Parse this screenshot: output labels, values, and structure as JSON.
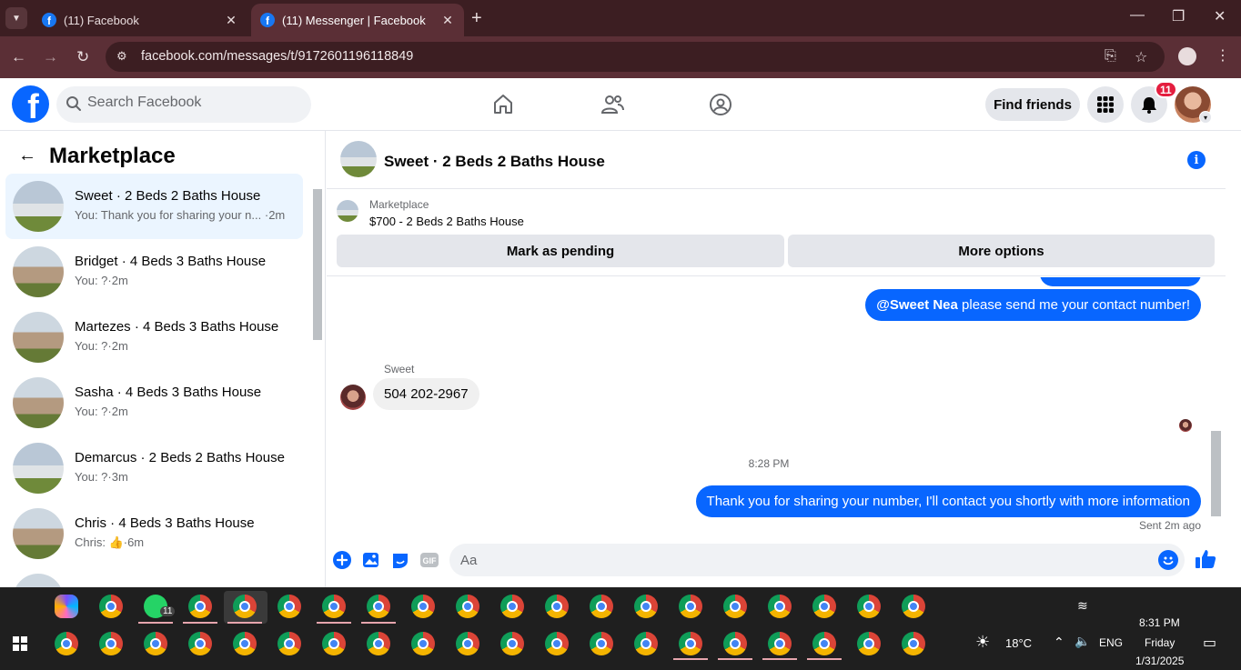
{
  "browser": {
    "tabs": [
      {
        "title": "(11) Facebook",
        "active": false
      },
      {
        "title": "(11) Messenger | Facebook",
        "active": true
      }
    ],
    "url": "facebook.com/messages/t/9172601196118849"
  },
  "fb": {
    "search_placeholder": "Search Facebook",
    "find_friends": "Find friends",
    "notification_count": "11"
  },
  "sidebar": {
    "title": "Marketplace",
    "conversations": [
      {
        "name": "Sweet · 2 Beds 2 Baths House",
        "snippet": "You: Thank you for sharing your n...",
        "time": "·2m",
        "thumb": "house-white",
        "active": true
      },
      {
        "name": "Bridget · 4 Beds 3 Baths House",
        "snippet": "You: ?",
        "time": "·2m",
        "thumb": "house-tan",
        "active": false
      },
      {
        "name": "Martezes · 4 Beds 3 Baths House",
        "snippet": "You: ?",
        "time": "·2m",
        "thumb": "house-tan",
        "active": false
      },
      {
        "name": "Sasha · 4 Beds 3 Baths House",
        "snippet": "You: ?",
        "time": "·2m",
        "thumb": "house-tan",
        "active": false
      },
      {
        "name": "Demarcus · 2 Beds 2 Baths House",
        "snippet": "You: ?",
        "time": "·3m",
        "thumb": "house-white",
        "active": false
      },
      {
        "name": "Chris · 4 Beds 3 Baths House",
        "snippet": "Chris: 👍",
        "time": "·6m",
        "thumb": "house-tan",
        "active": false
      }
    ]
  },
  "chat": {
    "title": "Sweet · 2 Beds 2 Baths House",
    "listing_kind": "Marketplace",
    "listing_price": "$700 - 2 Beds 2 Baths House",
    "mark_pending": "Mark as pending",
    "more_options": "More options",
    "messages": {
      "out1_mention": "@Sweet Nea",
      "out1_text": " please send me your contact number!",
      "in_sender": "Sweet",
      "in_text": "504 202-2967",
      "timestamp": "8:28 PM",
      "out2_text": "Thank you for sharing your number, I'll contact you shortly with more information",
      "sent_note": "Sent 2m ago"
    },
    "composer_placeholder": "Aa"
  },
  "taskbar": {
    "weather": "18°C",
    "lang": "ENG",
    "time": "8:31 PM",
    "day": "Friday",
    "date": "1/31/2025",
    "wa_badge": "11"
  }
}
